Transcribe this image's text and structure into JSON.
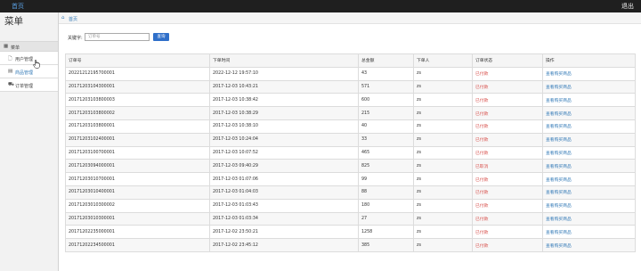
{
  "topbar": {
    "home": "首页",
    "logout": "退出"
  },
  "sidebar": {
    "title": "菜单",
    "section_label": "菜单",
    "items": [
      {
        "label": "用户管理",
        "icon": "file-icon"
      },
      {
        "label": "商品管理",
        "icon": "list-icon"
      },
      {
        "label": "订单管理",
        "icon": "car-icon"
      }
    ]
  },
  "breadcrumb": {
    "label": "首页"
  },
  "search": {
    "label": "关键字:",
    "placeholder": "订单号",
    "value": "",
    "button": "查询"
  },
  "table": {
    "headers": [
      "订单号",
      "下单时间",
      "总金额",
      "下单人",
      "订单状态",
      "操作"
    ],
    "rows": [
      {
        "id": "20221212195700001",
        "time": "2022-12-12 19:57:10",
        "total": "43",
        "user": "zs",
        "status": "已付款",
        "op": "查看购买商品"
      },
      {
        "id": "20171203104300001",
        "time": "2017-12-03 10:43:21",
        "total": "571",
        "user": "zs",
        "status": "已付款",
        "op": "查看购买商品"
      },
      {
        "id": "20171203103800003",
        "time": "2017-12-03 10:38:42",
        "total": "600",
        "user": "zs",
        "status": "已付款",
        "op": "查看购买商品"
      },
      {
        "id": "20171203103800002",
        "time": "2017-12-03 10:38:29",
        "total": "215",
        "user": "zs",
        "status": "已付款",
        "op": "查看购买商品"
      },
      {
        "id": "20171203103800001",
        "time": "2017-12-03 10:38:10",
        "total": "40",
        "user": "zs",
        "status": "已付款",
        "op": "查看购买商品"
      },
      {
        "id": "20171203102400001",
        "time": "2017-12-03 10:24:04",
        "total": "33",
        "user": "zs",
        "status": "已付款",
        "op": "查看购买商品"
      },
      {
        "id": "20171203100700001",
        "time": "2017-12-03 10:07:52",
        "total": "465",
        "user": "zs",
        "status": "已付款",
        "op": "查看购买商品"
      },
      {
        "id": "20171203094000001",
        "time": "2017-12-03 09:40:29",
        "total": "825",
        "user": "zs",
        "status": "已取消",
        "op": "查看购买商品"
      },
      {
        "id": "20171203010700001",
        "time": "2017-12-03 01:07:06",
        "total": "99",
        "user": "zs",
        "status": "已付款",
        "op": "查看购买商品"
      },
      {
        "id": "20171203010400001",
        "time": "2017-12-03 01:04:03",
        "total": "88",
        "user": "zs",
        "status": "已付款",
        "op": "查看购买商品"
      },
      {
        "id": "20171203010300002",
        "time": "2017-12-03 01:03:43",
        "total": "180",
        "user": "zs",
        "status": "已付款",
        "op": "查看购买商品"
      },
      {
        "id": "20171203010300001",
        "time": "2017-12-03 01:03:34",
        "total": "27",
        "user": "zs",
        "status": "已付款",
        "op": "查看购买商品"
      },
      {
        "id": "20171202235000001",
        "time": "2017-12-02 23:50:21",
        "total": "1258",
        "user": "zs",
        "status": "已付款",
        "op": "查看购买商品"
      },
      {
        "id": "20171202234500001",
        "time": "2017-12-02 23:45:12",
        "total": "385",
        "user": "zs",
        "status": "已付款",
        "op": "查看购买商品"
      }
    ]
  },
  "colors": {
    "link": "#337ab7",
    "status": "#d9534f",
    "button": "#2f6fc9",
    "topbar": "#1f1f1f"
  }
}
